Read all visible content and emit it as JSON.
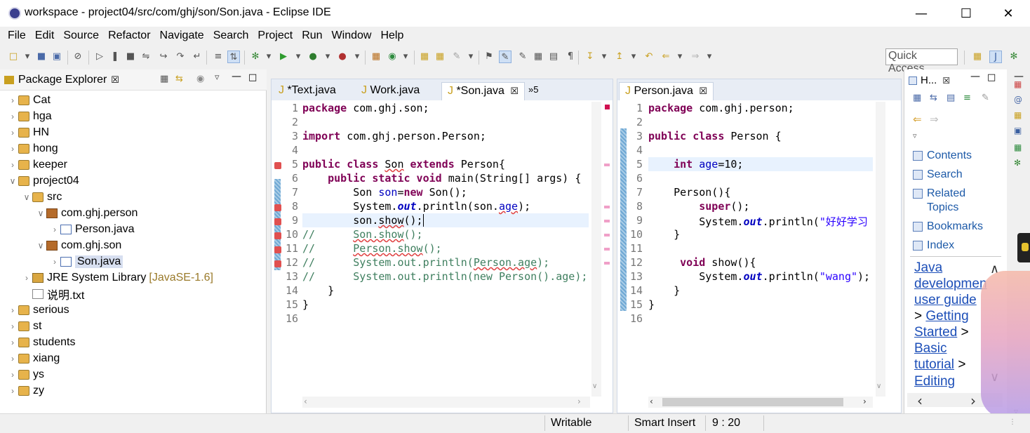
{
  "window": {
    "title": "workspace - project04/src/com/ghj/son/Son.java - Eclipse IDE",
    "minimize": "—",
    "maximize": "☐",
    "close": "✕"
  },
  "menu": [
    "File",
    "Edit",
    "Source",
    "Refactor",
    "Navigate",
    "Search",
    "Project",
    "Run",
    "Window",
    "Help"
  ],
  "toolbar": {
    "quick_access": "Quick Access"
  },
  "package_explorer": {
    "title": "Package Explorer",
    "close": "☒",
    "items": [
      {
        "label": "Cat",
        "arrow": "›",
        "icon": "project-icon"
      },
      {
        "label": "hga",
        "arrow": "›",
        "icon": "project-icon"
      },
      {
        "label": "HN",
        "arrow": "›",
        "icon": "project-icon"
      },
      {
        "label": "hong",
        "arrow": "›",
        "icon": "project-icon"
      },
      {
        "label": "keeper",
        "arrow": "›",
        "icon": "project-icon"
      },
      {
        "label": "project04",
        "arrow": "∨",
        "icon": "project-icon"
      },
      {
        "label": "src",
        "arrow": "∨",
        "icon": "source-folder-icon"
      },
      {
        "label": "com.ghj.person",
        "arrow": "∨",
        "icon": "package-icon"
      },
      {
        "label": "Person.java",
        "arrow": "›",
        "icon": "java-file-icon"
      },
      {
        "label": "com.ghj.son",
        "arrow": "∨",
        "icon": "package-icon"
      },
      {
        "label": "Son.java",
        "arrow": "›",
        "icon": "java-file-error-icon"
      },
      {
        "label": "JRE System Library",
        "suffix": "[JavaSE-1.6]",
        "arrow": "›",
        "icon": "library-icon"
      },
      {
        "label": "说明.txt",
        "arrow": "",
        "icon": "text-file-icon"
      },
      {
        "label": "serious",
        "arrow": "›",
        "icon": "project-icon"
      },
      {
        "label": "st",
        "arrow": "›",
        "icon": "project-icon"
      },
      {
        "label": "students",
        "arrow": "›",
        "icon": "project-icon"
      },
      {
        "label": "xiang",
        "arrow": "›",
        "icon": "project-icon"
      },
      {
        "label": "ys",
        "arrow": "›",
        "icon": "project-icon"
      },
      {
        "label": "zy",
        "arrow": "›",
        "icon": "project-icon"
      }
    ]
  },
  "editor_left": {
    "tabs": [
      {
        "label": "*Text.java"
      },
      {
        "label": "Work.java"
      },
      {
        "label": "*Son.java",
        "close": "☒"
      }
    ],
    "overflow": "»5",
    "line_numbers": [
      "1",
      "2",
      "3",
      "4",
      "5",
      "6",
      "7",
      "8",
      "9",
      "10",
      "11",
      "12",
      "13",
      "14",
      "15",
      "16"
    ]
  },
  "editor_right": {
    "tabs": [
      {
        "label": "Person.java",
        "close": "☒"
      }
    ],
    "line_numbers": [
      "1",
      "2",
      "3",
      "4",
      "5",
      "6",
      "7",
      "8",
      "9",
      "10",
      "11",
      "12",
      "13",
      "14",
      "15",
      "16"
    ]
  },
  "help": {
    "title": "H...",
    "close": "☒",
    "items": [
      "Contents",
      "Search",
      "Related",
      "Topics",
      "Bookmarks",
      "Index"
    ],
    "breadcrumb": [
      "Java",
      "developmen",
      "user guide",
      "Getting",
      "Started",
      "Basic",
      "tutorial",
      "Editing"
    ],
    "separator": ">"
  },
  "status": {
    "writable": "Writable",
    "insert_mode": "Smart Insert",
    "position": "9 : 20"
  }
}
